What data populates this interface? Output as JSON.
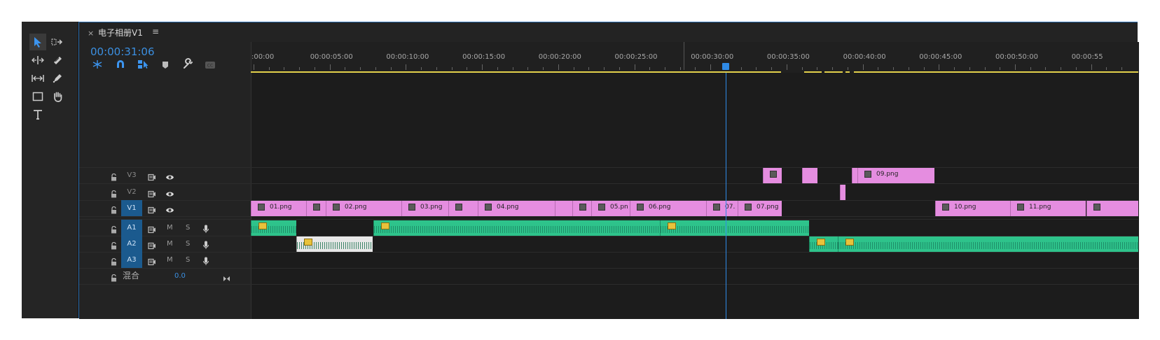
{
  "window": {
    "tab_close": "×",
    "title": "电子相册V1",
    "tab_menu": "≡"
  },
  "timeline": {
    "timecode": "00:00:31:06",
    "ruler_labels": [
      ":00:00",
      "00:00:05:00",
      "00:00:10:00",
      "00:00:15:00",
      "00:00:20:00",
      "00:00:25:00",
      "00:00:30:00",
      "00:00:35:00",
      "00:00:40:00",
      "00:00:45:00",
      "00:00:50:00",
      "00:00:55"
    ],
    "playhead_time": "00:00:31:06"
  },
  "icons": {
    "selection": "selection-tool-icon",
    "track_select": "track-select-tool-icon",
    "ripple": "ripple-edit-tool-icon",
    "razor": "razor-tool-icon",
    "slip": "slip-tool-icon",
    "pen": "pen-tool-icon",
    "rect": "rectangle-tool-icon",
    "hand": "hand-tool-icon",
    "type": "type-tool-icon"
  },
  "tracks": {
    "video": [
      {
        "name": "V3",
        "selected": false
      },
      {
        "name": "V2",
        "selected": false
      },
      {
        "name": "V1",
        "selected": true
      }
    ],
    "audio": [
      {
        "name": "A1",
        "m": "M",
        "s": "S",
        "selected": true
      },
      {
        "name": "A2",
        "m": "M",
        "s": "S",
        "selected": true
      },
      {
        "name": "A3",
        "m": "M",
        "s": "S",
        "selected": true
      }
    ],
    "mix": {
      "label": "混合",
      "value": "0.0"
    }
  },
  "clips": {
    "v1": [
      "01.png",
      "",
      "02.png",
      "03.png",
      "",
      "04.png",
      "",
      "",
      "05.pn",
      "06.png",
      "07.",
      "07.png",
      "10.png",
      "11.png"
    ],
    "v3": [
      "",
      "",
      "",
      "09.png"
    ]
  },
  "colors": {
    "accent": "#2f8ae6",
    "video_clip": "#e58de0",
    "audio_clip": "#2ec38b",
    "work_area": "#e2d04b"
  }
}
